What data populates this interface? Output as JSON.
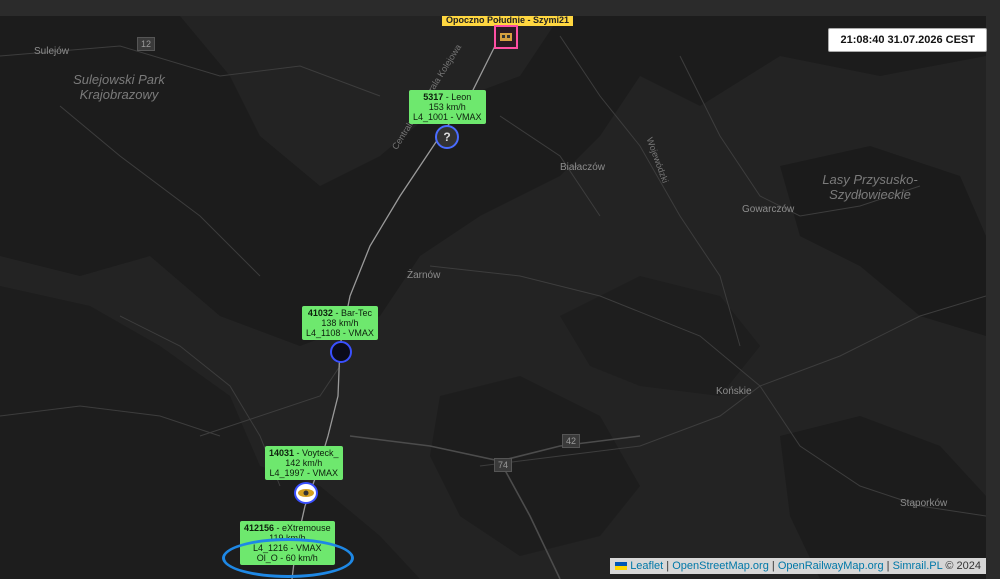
{
  "clock": {
    "text": "21:08:40 31.07.2026 CEST"
  },
  "map": {
    "places": {
      "sulejow": "Sulejów",
      "bialaczow": "Białaczów",
      "zarnow": "Żarnów",
      "gowarczow": "Gowarczów",
      "konskie": "Końskie",
      "staporkow": "Stąporków"
    },
    "parks": {
      "sulejowski": "Sulejowski Park Krajobrazowy",
      "przysusko": "Lasy Przysusko-Szydłowieckie"
    },
    "road_shields": {
      "r12": "12",
      "r42": "42",
      "r74": "74"
    },
    "road_labels": {
      "cmk": "Centralna Magistrala Kolejowa",
      "woj": "Wojewódzki"
    }
  },
  "station": {
    "label": "Opoczno Południe - Szymi21",
    "icon": "train-station-icon",
    "color": "#ff4fa3"
  },
  "trains": [
    {
      "number": "5317",
      "driver": "Leon",
      "speed": "153 km/h",
      "signal": "L4_1001 - VMAX",
      "icon": "unknown-avatar-icon"
    },
    {
      "number": "41032",
      "driver": "Bar-Tec",
      "speed": "138 km/h",
      "signal": "L4_1108 - VMAX",
      "icon": "dark-avatar-icon"
    },
    {
      "number": "14031",
      "driver": "Voyteck_",
      "speed": "142 km/h",
      "signal": "L4_1997 - VMAX",
      "icon": "winged-badge-icon"
    },
    {
      "number": "412156",
      "driver": "eXtremouse",
      "speed": "119 km/h",
      "signal": "L4_1216 - VMAX",
      "signal2": "Ol_O - 60 km/h",
      "icon": "avatar-icon"
    }
  ],
  "attribution": {
    "leaflet": "Leaflet",
    "sep1": " | ",
    "osm": "OpenStreetMap.org",
    "sep2": " | ",
    "orm": "OpenRailwayMap.org",
    "sep3": " | ",
    "simrail": "Simrail.PL",
    "copyright": " © 2024"
  },
  "colors": {
    "tooltip": "#6ee86e",
    "highlight_ring": "#1e88e5",
    "station_label": "#ffd740"
  }
}
